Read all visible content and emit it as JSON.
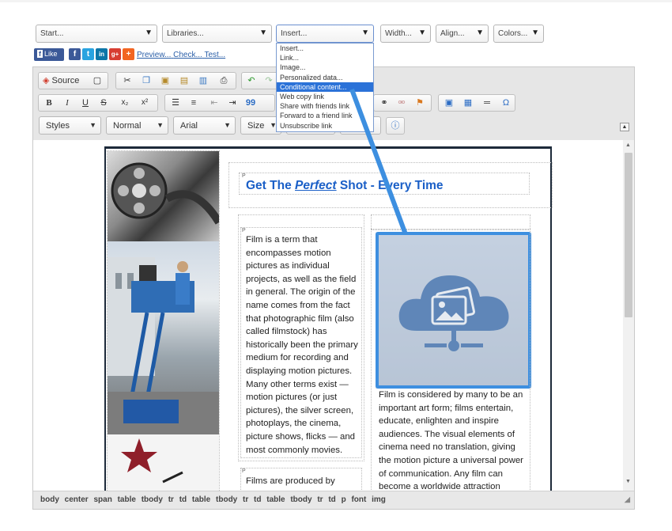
{
  "top_selects": [
    {
      "label": "Start..."
    },
    {
      "label": "Libraries..."
    },
    {
      "label": "Insert..."
    },
    {
      "label": "Width..."
    },
    {
      "label": "Align..."
    },
    {
      "label": "Colors..."
    }
  ],
  "social": {
    "like_label": "Like",
    "f": "f",
    "t": "t",
    "in": "in",
    "g": "g+",
    "plus": "+"
  },
  "links": {
    "preview": "Preview...",
    "check": "Check...",
    "test": "Test..."
  },
  "insert_menu": {
    "items": [
      "Insert...",
      "Link...",
      "Image...",
      "Personalized data...",
      "Conditional content...",
      "Web copy link",
      "Share with friends link",
      "Forward to a friend link",
      "Unsubscribe link"
    ],
    "highlighted": "Conditional content..."
  },
  "toolbar": {
    "source_label": "Source",
    "bold": "B",
    "italic": "I",
    "underline": "U",
    "strike": "S",
    "subscript": "x₂",
    "superscript": "x²",
    "quote": "99",
    "omega": "Ω"
  },
  "combos": {
    "styles": "Styles",
    "format": "Normal",
    "font": "Arial",
    "size": "Size"
  },
  "document": {
    "p_marker": "P",
    "title_pre": "Get The ",
    "title_em": "Perfect",
    "title_post": " Shot - Every Time",
    "left_para": [
      "Film is a term that",
      "encompasses motion",
      "pictures as individual",
      "projects, as well as the field",
      "in general. The origin of the",
      "name comes from the fact",
      "that photographic film (also",
      "called filmstock) has",
      "historically been the primary",
      "medium for recording and",
      "displaying motion pictures.",
      "Many other terms exist —",
      "motion pictures (or just",
      "pictures), the silver screen,",
      "photoplays, the cinema,",
      "picture shows, flicks — and",
      "most commonly movies."
    ],
    "left_para2": [
      "Films are produced by"
    ],
    "right_para": [
      "Film is considered by many to be an",
      "important art form; films entertain,",
      "educate, enlighten and inspire",
      "audiences. The visual elements of",
      "cinema need no translation, giving",
      "the motion picture a universal power",
      "of communication. Any film can",
      "become a worldwide attraction"
    ]
  },
  "statusbar": {
    "path": "body center span table tbody tr td table tbody tr td table tbody tr td p font img"
  },
  "colors": {
    "accent_blue": "#3d8fe0",
    "link_blue": "#1a5fc7",
    "highlight": "#2b72d8"
  }
}
